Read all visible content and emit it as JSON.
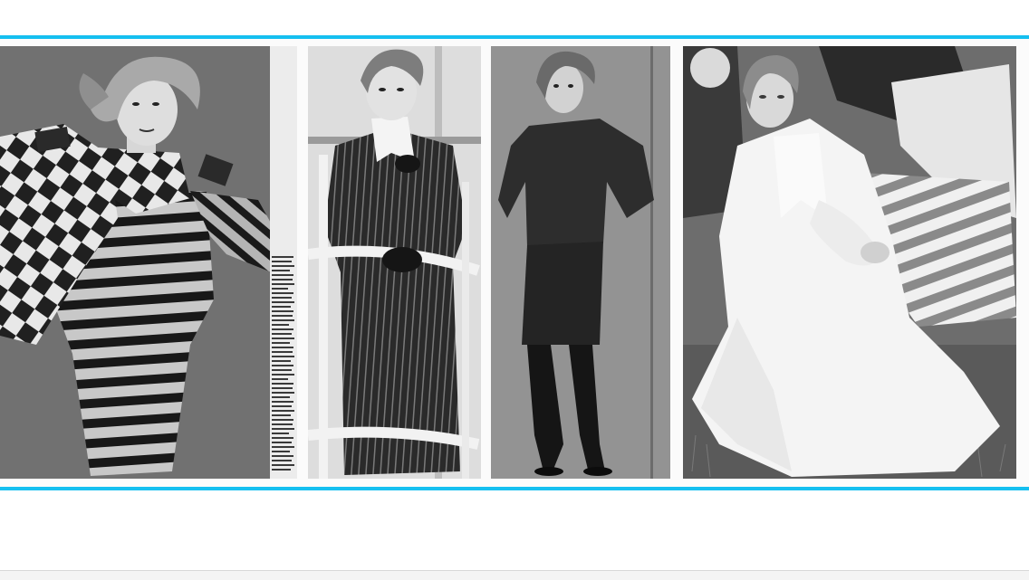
{
  "accent_color": "#15bff0",
  "footer_color": "#f4f4f4",
  "photos": [
    {
      "subject": "woman-striped-sweater-dress-checkered-scarf"
    },
    {
      "subject": "woman-pinstripe-coat-with-chair"
    },
    {
      "subject": "woman-dark-sweater-and-skirt"
    },
    {
      "subject": "woman-white-outfit-seated-on-grass"
    }
  ]
}
